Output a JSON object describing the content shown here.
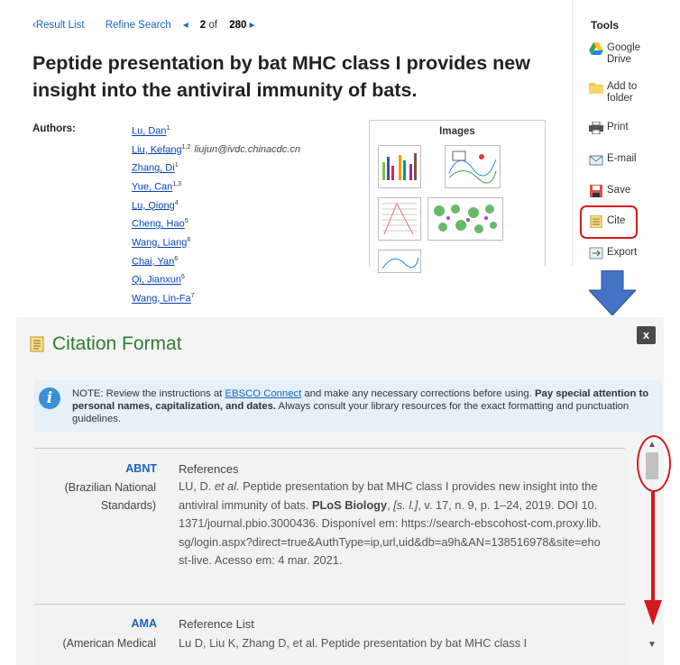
{
  "nav": {
    "result_list": "Result List",
    "refine_search": "Refine Search",
    "pager_current": "2",
    "pager_of": "of",
    "pager_total": "280"
  },
  "article": {
    "title": "Peptide presentation by bat MHC class I provides new insight into the antiviral immunity of bats.",
    "authors_label": "Authors:",
    "authors": [
      {
        "name": "Lu, Dan",
        "sup": "1"
      },
      {
        "name": "Liu, Kefang",
        "sup": "1,2",
        "email": "liujun@ivdc.chinacdc.cn"
      },
      {
        "name": "Zhang, Di",
        "sup": "1"
      },
      {
        "name": "Yue, Can",
        "sup": "1,3"
      },
      {
        "name": "Lu, Qiong",
        "sup": "4"
      },
      {
        "name": "Cheng, Hao",
        "sup": "5"
      },
      {
        "name": "Wang, Liang",
        "sup": "6"
      },
      {
        "name": "Chai, Yan",
        "sup": "6"
      },
      {
        "name": "Qi, Jianxun",
        "sup": "6"
      },
      {
        "name": "Wang, Lin-Fa",
        "sup": "7"
      }
    ],
    "images_label": "Images"
  },
  "tools": {
    "heading": "Tools",
    "items": [
      "Google Drive",
      "Add to folder",
      "Print",
      "E-mail",
      "Save",
      "Cite",
      "Export"
    ]
  },
  "dialog": {
    "title": "Citation Format",
    "close": "x",
    "note": {
      "prefix": "NOTE: Review the instructions at ",
      "link": "EBSCO Connect",
      "middle": " and make any necessary corrections before using. ",
      "bold": "Pay special attention to personal names, capitalization, and dates.",
      "suffix": " Always consult your library resources for the exact formatting and punctuation guidelines."
    },
    "citations": [
      {
        "style": "ABNT",
        "desc": "(Brazilian National Standards)",
        "heading": "References",
        "p1": "LU, D. ",
        "p1_italic": "et al.",
        "p2": " Peptide presentation by bat MHC class I provides new insight into the antiviral immunity of bats. ",
        "journal": "PLoS Biology",
        "p3": ", ",
        "p3_italic": "[s. l.]",
        "p4": ", v. 17, n. 9, p. 1–24, 2019. DOI 10.1371/journal.pbio.3000436. Disponível em: https://search-ebscohost-com.proxy.lib.sg/login.aspx?direct=true&AuthType=ip,url,uid&db=a9h&AN=138516978&site=ehost-live. Acesso em: 4 mar. 2021."
      },
      {
        "style": "AMA",
        "desc": "(American Medical",
        "heading": "Reference List",
        "text": "Lu D, Liu K, Zhang D, et al. Peptide presentation by bat MHC class I"
      }
    ]
  },
  "colors": {
    "highlight_red": "#d7191c",
    "arrow_blue": "#4472c4",
    "link_blue": "#1565c0",
    "title_green": "#2e7d32"
  }
}
